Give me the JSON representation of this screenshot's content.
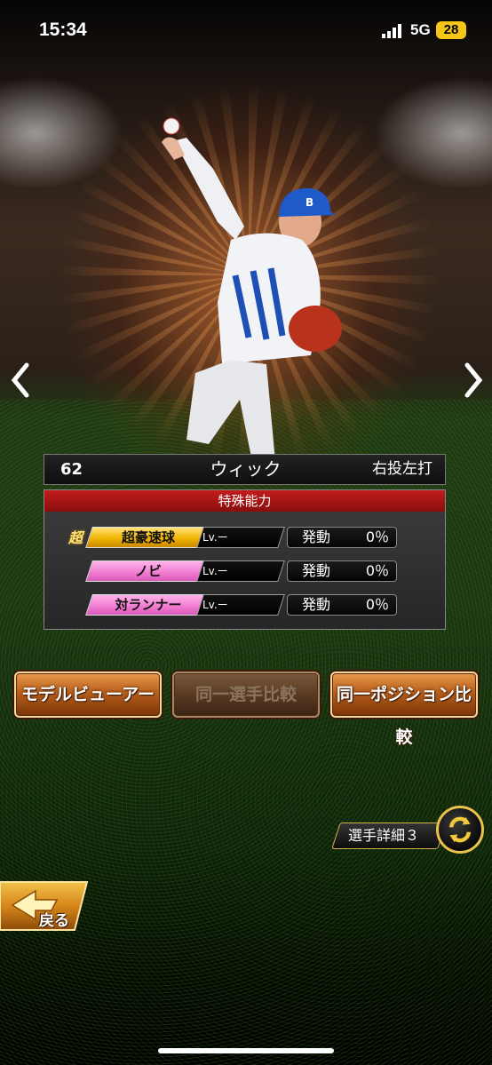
{
  "status_bar": {
    "time": "15:34",
    "network": "5G",
    "battery": "28"
  },
  "player": {
    "number": "62",
    "name": "ウィック",
    "handedness": "右投左打"
  },
  "abilities": {
    "header": "特殊能力",
    "items": [
      {
        "badge": "超",
        "name": "超豪速球",
        "level": "Lv.ー",
        "trigger_label": "発動",
        "trigger_value": "0％",
        "style": "gold"
      },
      {
        "badge": "",
        "name": "ノビ",
        "level": "Lv.ー",
        "trigger_label": "発動",
        "trigger_value": "0％",
        "style": "pink"
      },
      {
        "badge": "",
        "name": "対ランナー",
        "level": "Lv.ー",
        "trigger_label": "発動",
        "trigger_value": "0％",
        "style": "pink"
      }
    ]
  },
  "actions": {
    "model_viewer": "モデルビューアー",
    "same_player_compare": "同一選手比較",
    "same_position_compare": "同一ポジション比較"
  },
  "detail": {
    "label": "選手詳細３"
  },
  "back": {
    "label": "戻る"
  },
  "colors": {
    "ability_header": "#c21c1c",
    "gold_tag": "#f0b400",
    "pink_tag": "#f07ad0",
    "button_orange": "#b85f1c",
    "detail_border": "#d6b24e"
  },
  "icons": {
    "nav_prev": "chevron-left-icon",
    "nav_next": "chevron-right-icon",
    "cycle": "cycle-arrows-icon",
    "back": "back-arrow-icon"
  }
}
